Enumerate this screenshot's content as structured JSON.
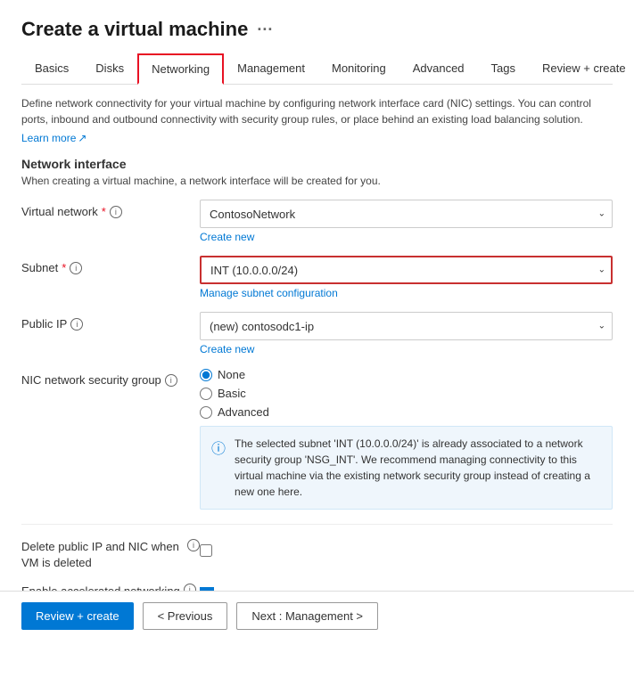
{
  "page": {
    "title": "Create a virtual machine",
    "title_dots": "···"
  },
  "tabs": [
    {
      "id": "basics",
      "label": "Basics",
      "active": false
    },
    {
      "id": "disks",
      "label": "Disks",
      "active": false
    },
    {
      "id": "networking",
      "label": "Networking",
      "active": true
    },
    {
      "id": "management",
      "label": "Management",
      "active": false
    },
    {
      "id": "monitoring",
      "label": "Monitoring",
      "active": false
    },
    {
      "id": "advanced",
      "label": "Advanced",
      "active": false
    },
    {
      "id": "tags",
      "label": "Tags",
      "active": false
    },
    {
      "id": "review-create",
      "label": "Review + create",
      "active": false
    }
  ],
  "description": "Define network connectivity for your virtual machine by configuring network interface card (NIC) settings. You can control ports, inbound and outbound connectivity with security group rules, or place behind an existing load balancing solution.",
  "learn_more": "Learn more",
  "network_interface": {
    "section_title": "Network interface",
    "section_desc": "When creating a virtual machine, a network interface will be created for you.",
    "virtual_network_label": "Virtual network",
    "virtual_network_required": "*",
    "virtual_network_value": "ContosoNetwork",
    "create_new_vnet": "Create new",
    "subnet_label": "Subnet",
    "subnet_required": "*",
    "subnet_value": "INT (10.0.0.0/24)",
    "manage_subnet": "Manage subnet configuration",
    "public_ip_label": "Public IP",
    "public_ip_value": "(new) contosodc1-ip",
    "create_new_ip": "Create new",
    "nic_nsg_label": "NIC network security group",
    "radio_none": "None",
    "radio_basic": "Basic",
    "radio_advanced": "Advanced",
    "selected_radio": "None",
    "info_message": "The selected subnet 'INT (10.0.0.0/24)' is already associated to a network security group 'NSG_INT'. We recommend managing connectivity to this virtual machine via the existing network security group instead of creating a new one here."
  },
  "delete_public_ip": {
    "label": "Delete public IP and NIC when VM is deleted",
    "checked": false
  },
  "accelerated_networking": {
    "label": "Enable accelerated networking",
    "checked": true
  },
  "footer": {
    "review_create": "Review + create",
    "previous": "< Previous",
    "next": "Next : Management >"
  }
}
